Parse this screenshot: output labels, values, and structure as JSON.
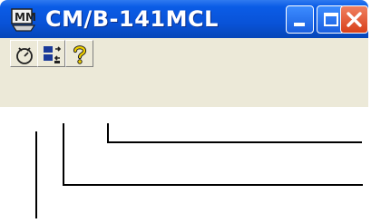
{
  "window": {
    "title": "CM/B-141MCL",
    "app_icon": "app-icon",
    "controls": [
      "minimize-button",
      "maximize-button",
      "close-button"
    ]
  },
  "toolbar": {
    "buttons": [
      {
        "name": "stopwatch-icon"
      },
      {
        "name": "connection-icon"
      },
      {
        "name": "help-icon"
      }
    ]
  },
  "colors": {
    "titlebar": "#0a5ce6",
    "close": "#d8401a",
    "toolbar_bg": "#ece9d8"
  }
}
